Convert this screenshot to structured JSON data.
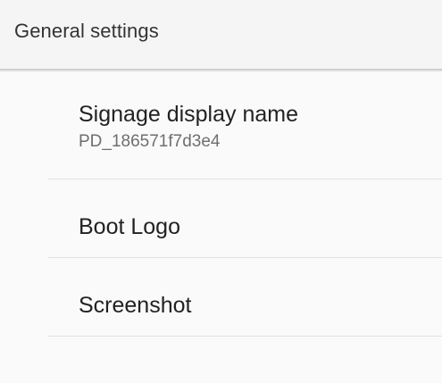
{
  "header": {
    "title": "General settings"
  },
  "settings": {
    "items": [
      {
        "title": "Signage display name",
        "summary": "PD_186571f7d3e4"
      },
      {
        "title": "Boot Logo"
      },
      {
        "title": "Screenshot"
      }
    ]
  }
}
